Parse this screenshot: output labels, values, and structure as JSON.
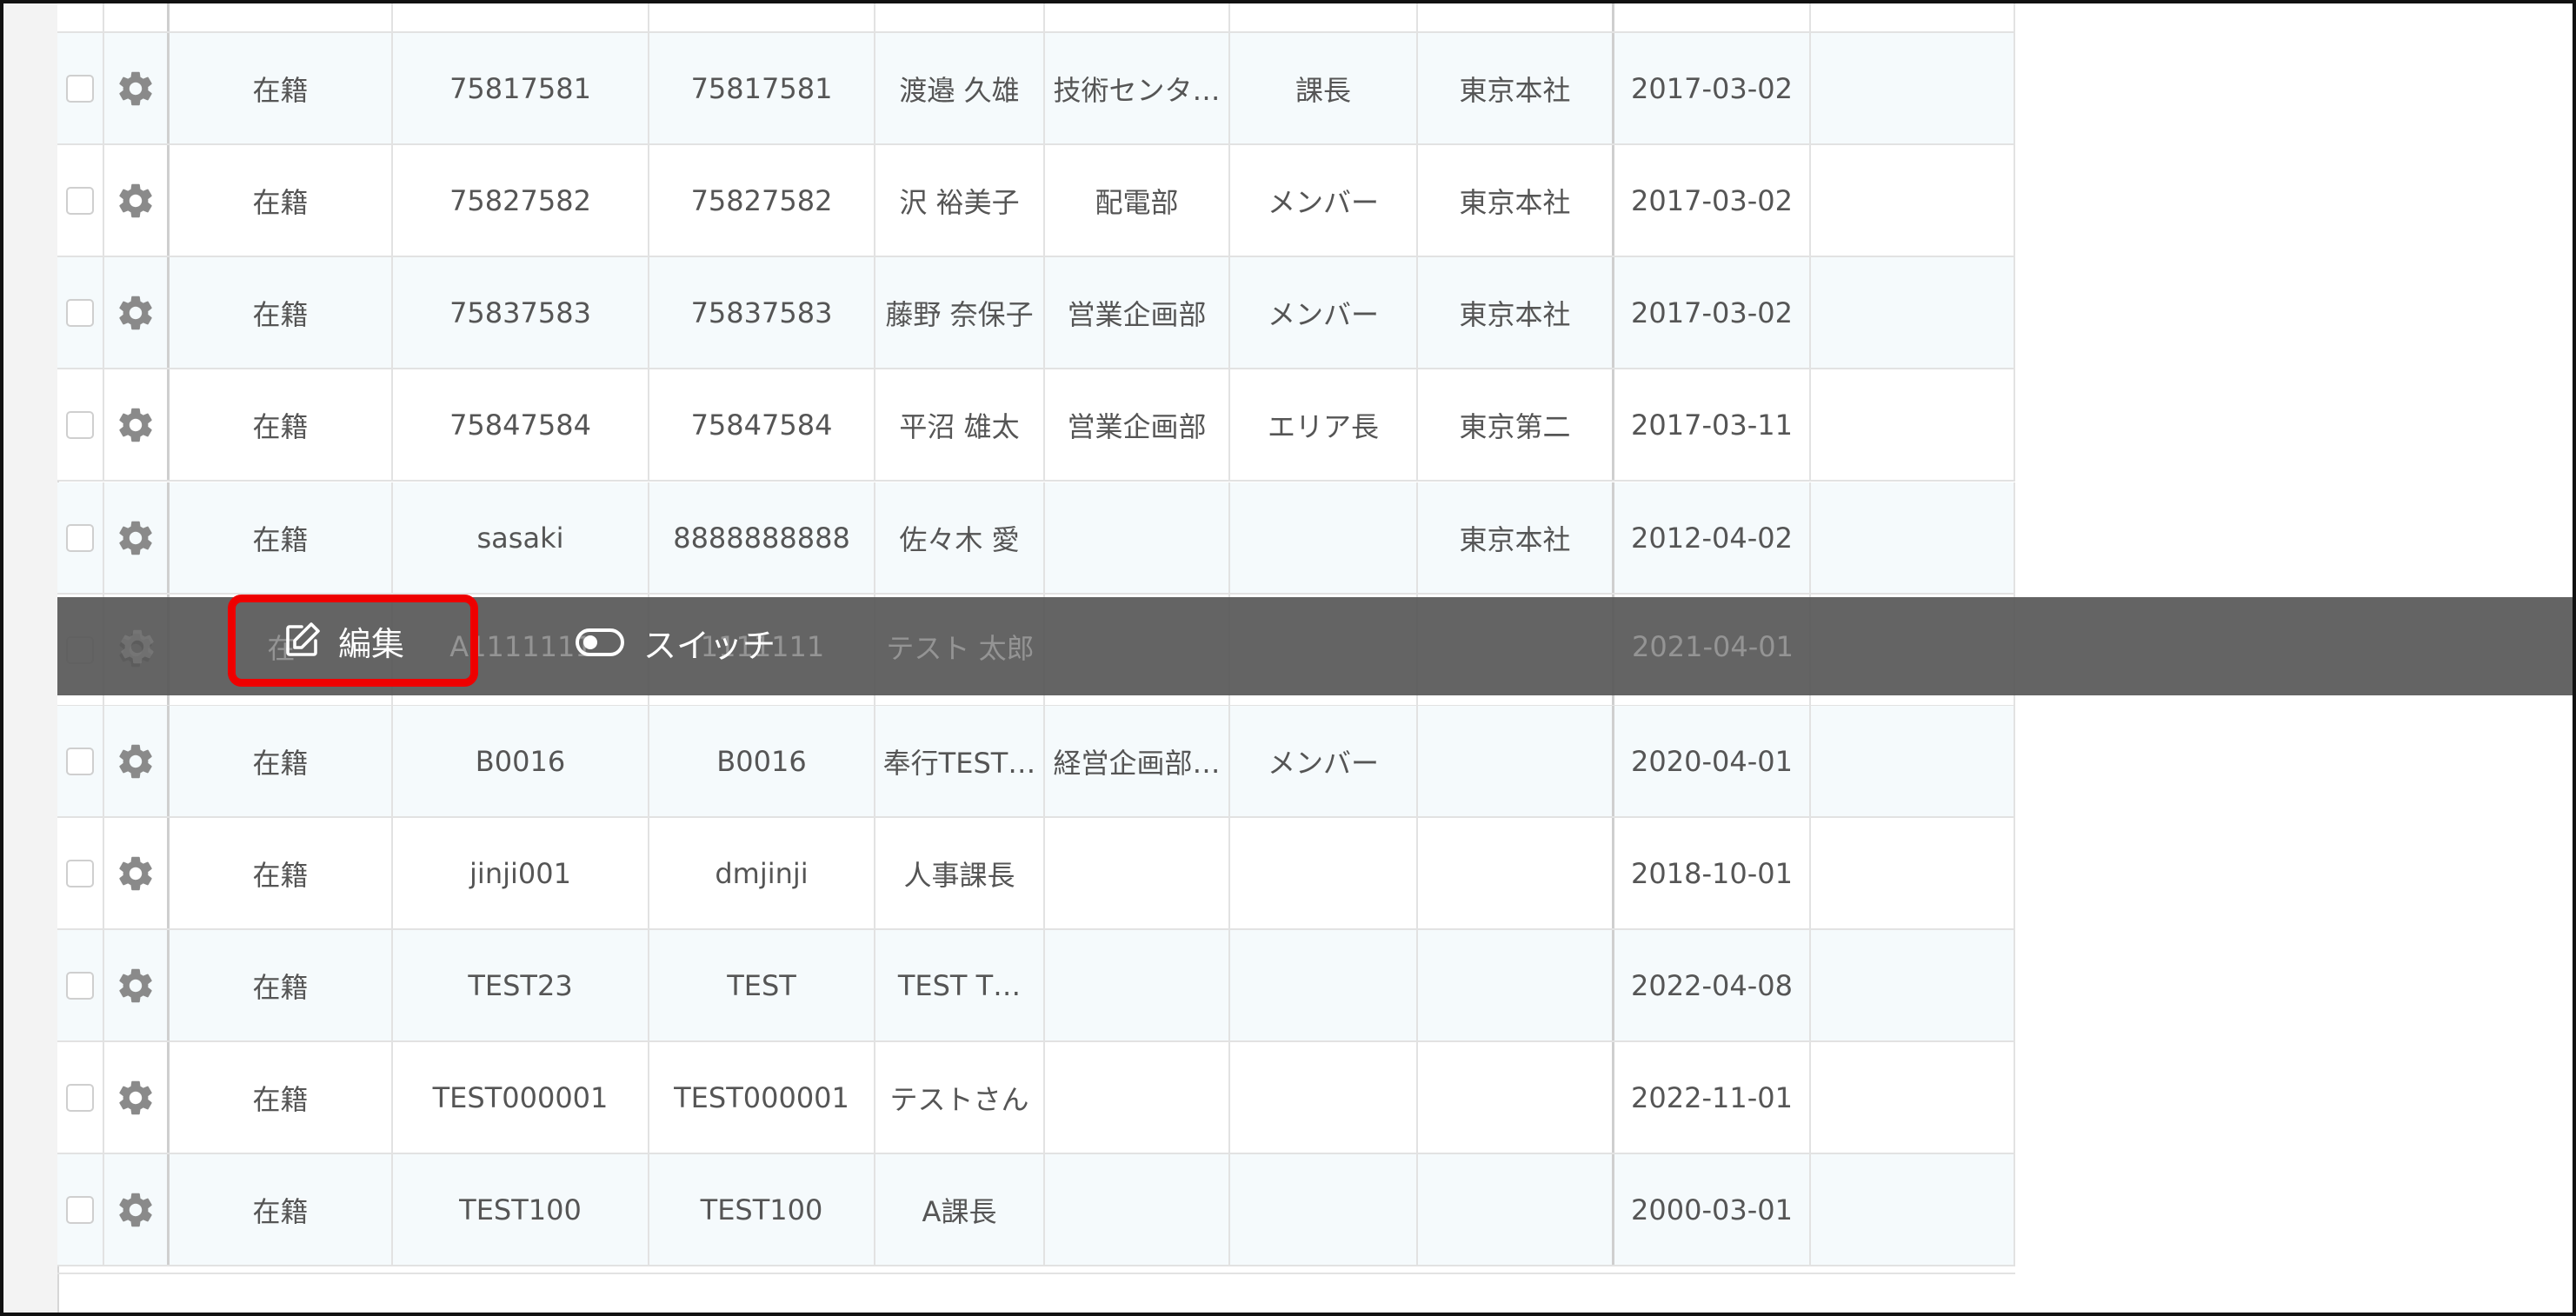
{
  "table": {
    "rows": [
      {
        "status": "在籍",
        "employee_id": "75817581",
        "code": "75817581",
        "name": "渡邉 久雄",
        "department": "技術センタ…",
        "position": "課長",
        "office": "東京本社",
        "date": "2017-03-02"
      },
      {
        "status": "在籍",
        "employee_id": "75827582",
        "code": "75827582",
        "name": "沢 裕美子",
        "department": "配電部",
        "position": "メンバー",
        "office": "東京本社",
        "date": "2017-03-02"
      },
      {
        "status": "在籍",
        "employee_id": "75837583",
        "code": "75837583",
        "name": "藤野 奈保子",
        "department": "営業企画部",
        "position": "メンバー",
        "office": "東京本社",
        "date": "2017-03-02"
      },
      {
        "status": "在籍",
        "employee_id": "75847584",
        "code": "75847584",
        "name": "平沼 雄太",
        "department": "営業企画部",
        "position": "エリア長",
        "office": "東京第二",
        "date": "2017-03-11"
      },
      {
        "status": "在籍",
        "employee_id": "sasaki",
        "code": "8888888888",
        "name": "佐々木 愛",
        "department": "",
        "position": "",
        "office": "東京本社",
        "date": "2012-04-02"
      },
      {
        "status": "在",
        "employee_id": "A1111111",
        "code": "1111111",
        "name": "テスト 太郎",
        "department": "",
        "position": "",
        "office": "",
        "date": "2021-04-01"
      },
      {
        "status": "在籍",
        "employee_id": "B0016",
        "code": "B0016",
        "name": "奉行TEST…",
        "department": "経営企画部…",
        "position": "メンバー",
        "office": "",
        "date": "2020-04-01"
      },
      {
        "status": "在籍",
        "employee_id": "jinji001",
        "code": "dmjinji",
        "name": "人事課長",
        "department": "",
        "position": "",
        "office": "",
        "date": "2018-10-01"
      },
      {
        "status": "在籍",
        "employee_id": "TEST23",
        "code": "TEST",
        "name": "TEST T…",
        "department": "",
        "position": "",
        "office": "",
        "date": "2022-04-08"
      },
      {
        "status": "在籍",
        "employee_id": "TEST000001",
        "code": "TEST000001",
        "name": "テストさん",
        "department": "",
        "position": "",
        "office": "",
        "date": "2022-11-01"
      },
      {
        "status": "在籍",
        "employee_id": "TEST100",
        "code": "TEST100",
        "name": "A課長",
        "department": "",
        "position": "",
        "office": "",
        "date": "2000-03-01"
      }
    ]
  },
  "action_bar": {
    "edit_label": "編集",
    "switch_label": "スイッチ"
  },
  "colors": {
    "highlight": "#ee0000",
    "action_bar": "#585858",
    "row_alt": "#f5fafc"
  }
}
